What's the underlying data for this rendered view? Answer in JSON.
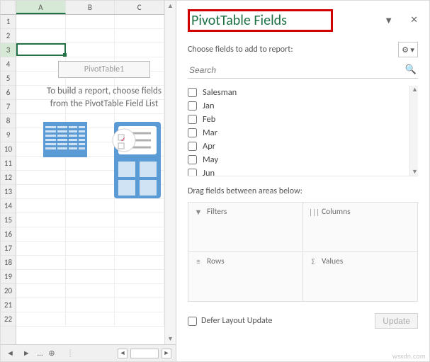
{
  "sheet": {
    "columns": [
      "A",
      "B",
      "C"
    ],
    "rows": 22,
    "active_cell": "A3",
    "pivot_placeholder": {
      "name": "PivotTable1",
      "message": "To build a report, choose fields from the PivotTable Field List"
    },
    "tab_ellipsis": "…"
  },
  "pane": {
    "title": "PivotTable Fields",
    "dropdown_glyph": "▼",
    "close_glyph": "✕",
    "choose_label": "Choose fields to add to report:",
    "gear_glyph": "⚙ ▾",
    "search": {
      "placeholder": "Search",
      "icon": "🔍"
    },
    "fields": [
      "Salesman",
      "Jan",
      "Feb",
      "Mar",
      "Apr",
      "May",
      "Jun"
    ],
    "drag_label": "Drag fields between areas below:",
    "areas": {
      "filters": {
        "icon": "▼",
        "label": "Filters"
      },
      "columns": {
        "icon": "|||",
        "label": "Columns"
      },
      "rows": {
        "icon": "≡",
        "label": "Rows"
      },
      "values": {
        "icon": "Σ",
        "label": "Values"
      }
    },
    "defer_label": "Defer Layout Update",
    "update_label": "Update"
  },
  "watermark": "wsxdn.com"
}
